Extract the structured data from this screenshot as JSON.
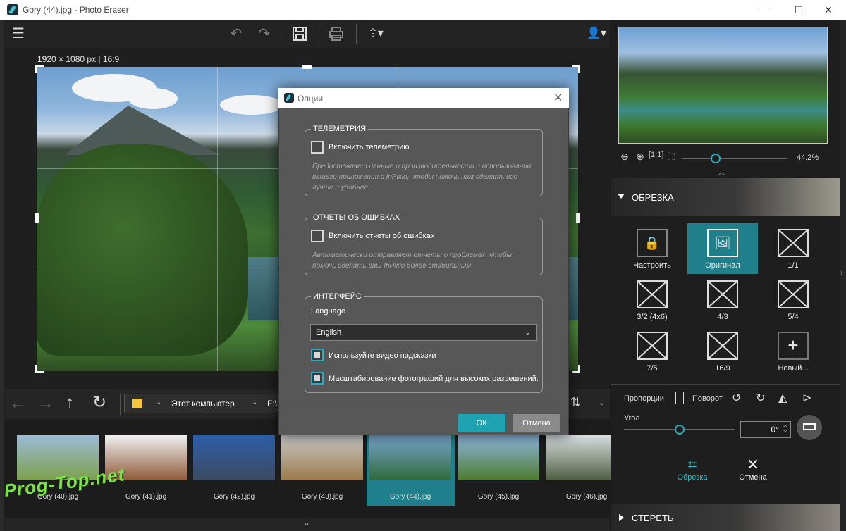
{
  "window": {
    "title": "Gory (44).jpg - Photo Eraser",
    "minimize": "—",
    "maximize": "☐",
    "close": "✕"
  },
  "canvas": {
    "dimensions": "1920 × 1080 px | 16:9"
  },
  "nav": {
    "location": "Этот компьютер",
    "drive": "F:\\"
  },
  "thumbnails": [
    {
      "label": "Gory (40).jpg",
      "colors": [
        "#9cbbd8",
        "#7da04b"
      ]
    },
    {
      "label": "Gory (41).jpg",
      "colors": [
        "#f0f0f0",
        "#8f5a3a"
      ]
    },
    {
      "label": "Gory (42).jpg",
      "colors": [
        "#2d5fa8",
        "#3b4a60"
      ]
    },
    {
      "label": "Gory (43).jpg",
      "colors": [
        "#c9c9c9",
        "#9a7a4a"
      ]
    },
    {
      "label": "Gory (44).jpg",
      "colors": [
        "#7ba6d0",
        "#2f6a3a"
      ],
      "selected": true
    },
    {
      "label": "Gory (45).jpg",
      "colors": [
        "#8fb7e0",
        "#4e7a2e"
      ]
    },
    {
      "label": "Gory (46).jpg",
      "colors": [
        "#d8dde0",
        "#4f5e40"
      ]
    }
  ],
  "right": {
    "zoom": "44.2%",
    "crop_header": "ОБРЕЗКА",
    "ratios": [
      "Настроить",
      "Оригинал",
      "1/1",
      "3/2 (4x6)",
      "4/3",
      "5/4",
      "7/5",
      "16/9",
      "Новый..."
    ],
    "proportions": "Пропорции",
    "rotate": "Поворот",
    "angle_label": "Угол",
    "angle_value": "0°",
    "apply": "Обрезка",
    "cancel": "Отмена",
    "erase_header": "СТЕРЕТЬ"
  },
  "dialog": {
    "title": "Опции",
    "telemetry": {
      "title": "ТЕЛЕМЕТРИЯ",
      "checkbox": "Включить телеметрию",
      "desc": "Предоставляет данные о производительности и использовании вашего приложения с InPixio, чтобы помочь нам сделать его лучше и удобнее."
    },
    "errors": {
      "title": "ОТЧЕТЫ ОБ ОШИБКАХ",
      "checkbox": "Включить отчеты об ошибках",
      "desc": "Автоматически отправляет отчеты о проблемах, чтобы помочь сделать ваш InPixio более стабильным."
    },
    "interface": {
      "title": "ИНТЕРФЕЙС",
      "language_label": "Language",
      "language_value": "English",
      "video_hints": "Используйте видео подсказки",
      "hidpi": "Масштабирование фотографий для высоких разрешений."
    },
    "ok": "ОК",
    "cancel": "Отмена"
  },
  "watermark": "Prog-Top.net",
  "colors": {
    "accent": "#1fa3b2",
    "background": "#1b1b1b"
  }
}
